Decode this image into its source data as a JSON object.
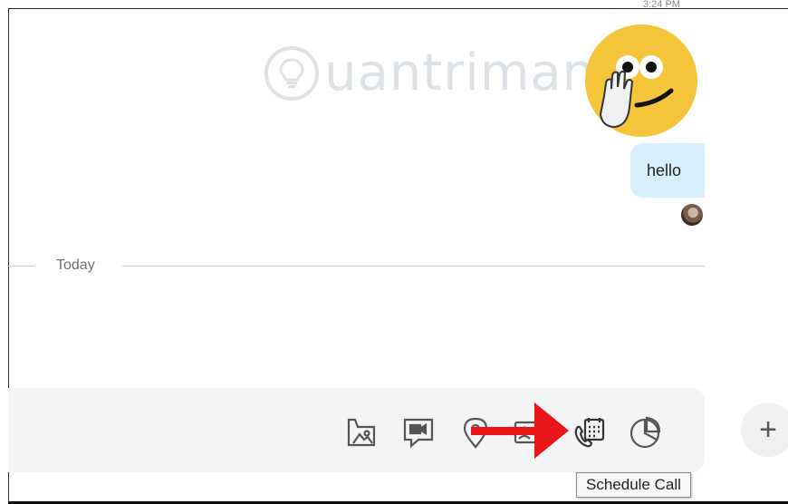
{
  "header": {
    "time_partial": "3:24 PM"
  },
  "watermark": {
    "text": "uantrimang"
  },
  "messages": [
    {
      "type": "sticker",
      "name": "wave-sticker"
    },
    {
      "type": "text",
      "text": "hello"
    }
  ],
  "divider": {
    "label": "Today"
  },
  "composer": {
    "tools": [
      {
        "name": "send-file",
        "icon": "image-file-icon"
      },
      {
        "name": "video-message",
        "icon": "video-message-icon"
      },
      {
        "name": "location",
        "icon": "location-pin-icon"
      },
      {
        "name": "contacts",
        "icon": "contact-card-icon"
      },
      {
        "name": "schedule-call",
        "icon": "schedule-call-icon"
      },
      {
        "name": "poll",
        "icon": "poll-icon"
      }
    ],
    "plus_label": "+"
  },
  "tooltip": {
    "text": "Schedule Call"
  },
  "colors": {
    "bubble": "#d8f0fb",
    "arrow": "#e8151b",
    "sticker": "#f4c53a"
  }
}
